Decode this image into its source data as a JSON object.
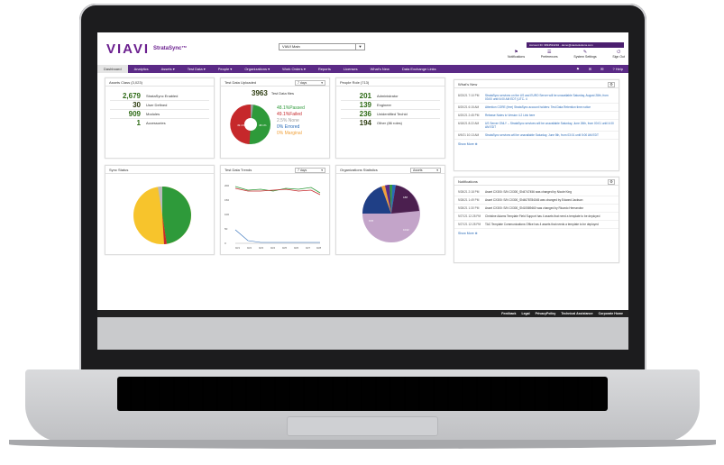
{
  "app": {
    "logo": "VIAVI",
    "product": "StrataSync™",
    "account_select": "VIAVI Main",
    "account_bar": "Account ID: 9834534294 · demo@viavisolutions.com",
    "top_links": [
      {
        "icon": "flag-icon",
        "glyph": "⚑",
        "label": "Notifications"
      },
      {
        "icon": "sliders-icon",
        "glyph": "☰",
        "label": "Preferences"
      },
      {
        "icon": "wrench-icon",
        "glyph": "✎",
        "label": "System Settings"
      },
      {
        "icon": "power-icon",
        "glyph": "⏻",
        "label": "Sign Out"
      }
    ]
  },
  "nav": {
    "items": [
      "Dashboard",
      "Analytics",
      "Assets ▾",
      "Test Data ▾",
      "People ▾",
      "Organizations ▾",
      "Work Orders ▾",
      "Reports",
      "Licenses",
      "What's New",
      "Data Exchange Links"
    ],
    "right": [
      "⚑",
      "✉",
      "✉",
      "? Help"
    ]
  },
  "assets": {
    "title": "Assets Class (3,023)",
    "rows": [
      {
        "num": "2,679",
        "label": "StrataSync Enabled"
      },
      {
        "num": "30",
        "label": "User Defined"
      },
      {
        "num": "909",
        "label": "Modules"
      },
      {
        "num": "1",
        "label": "Accessories"
      }
    ]
  },
  "testdata": {
    "title": "Test Data Uploaded",
    "period": "7 days",
    "total_num": "3963",
    "total_label": "Test Data files",
    "legend": [
      {
        "pct": "48.1%",
        "label": "Passed",
        "color": "#2e9a3a"
      },
      {
        "pct": "49.1%",
        "label": "Failed",
        "color": "#c6282b"
      },
      {
        "pct": "2.5%",
        "label": "None",
        "color": "#9a9a9a"
      },
      {
        "pct": "0%",
        "label": "Errored",
        "color": "#2a6ab7"
      },
      {
        "pct": "0%",
        "label": "Marginal",
        "color": "#f0a13a"
      }
    ],
    "pie_labels": [
      "49.1%",
      "48.1%"
    ]
  },
  "people": {
    "title": "People Role (713)",
    "rows": [
      {
        "num": "201",
        "label": "Administrator"
      },
      {
        "num": "139",
        "label": "Engineer"
      },
      {
        "num": "236",
        "label": "Unidentified Techid"
      },
      {
        "num": "194",
        "label": "Other (86 roles)"
      }
    ]
  },
  "whatsnew": {
    "title": "What's New",
    "items": [
      {
        "t": "8/23/21 7:10 PM",
        "m": "StrataSync services on the US and EURO Server will be unavailable Saturday, August 28th, from 03:00 until 6:00 AM EDT (UTC- 4"
      },
      {
        "t": "8/20/21 6:15 AM",
        "m": "Attention CORE (free) StrataSync account holders: Test Data Retention time notice"
      },
      {
        "t": "6/20/21 2:45 PM",
        "m": "Release Notes to Version 4.2 Link here"
      },
      {
        "t": "6/18/21 8:22 AM",
        "m": "US Server ONLY -- StrataSync services will be unavailable Saturday, June 26th, from 00:01 until 4:00 AM EDT"
      },
      {
        "t": "6/9/21 10:13 AM",
        "m": "StrataSync services will be unavailable Saturday, June 5th, from 03:01 until 5:00 AM EDT"
      }
    ],
    "show_more": "Show More ⊕"
  },
  "sync": {
    "title": "Sync Status"
  },
  "trends": {
    "title": "Test Data Trends",
    "period": "7 days",
    "y_ticks": [
      "200",
      "150",
      "100",
      "50",
      "0"
    ],
    "x_ticks": [
      "9/21",
      "9/22",
      "9/23",
      "9/24",
      "9/25",
      "9/26",
      "9/27",
      "9/28"
    ]
  },
  "orgstats": {
    "title": "Organizations Statistics",
    "select": "Assets",
    "pie_labels": [
      "188",
      "678",
      "1042"
    ]
  },
  "notifications": {
    "title": "Notifications",
    "items": [
      {
        "t": "9/28/21 2:18 PM",
        "m": "Asset CX300: S/N CX300_SN4747456 was changed by Nicole King"
      },
      {
        "t": "9/28/21 1:49 PM",
        "m": "Asset CX300: S/N CX300_SN4678784045 was changed by Edward Jackson"
      },
      {
        "t": "9/28/21 1:30 PM",
        "m": "Asset CX300: S/N CX300_SN10589460 was changed by Ricardo Hernandez"
      },
      {
        "t": "9/27/21 12:28 PM",
        "m": "Christine Adams Template Field Support has 4 assets that need a template to be deployed"
      },
      {
        "t": "9/27/21 12:28 PM",
        "m": "TAC Template Communications Office has 4 assets that needs a template to be deployed"
      }
    ],
    "show_more": "Show More ⊕"
  },
  "footer": [
    "Feedback",
    "Legal",
    "PrivacyPolicy",
    "Technical Assistance",
    "Corporate Home"
  ],
  "colors": {
    "brand": "#5b2a86",
    "green": "#2e9a3a",
    "red": "#c6282b",
    "yellow": "#f7c42c",
    "navy": "#1f3f86",
    "mauve": "#c3a4c9"
  }
}
